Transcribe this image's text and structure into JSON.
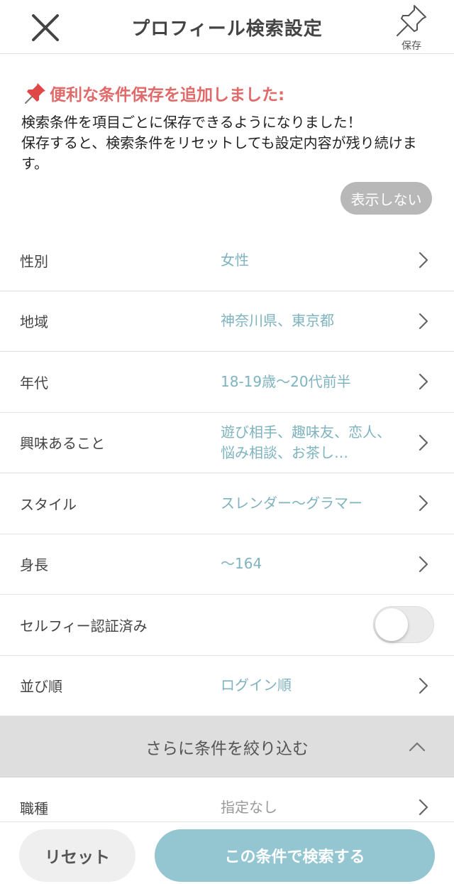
{
  "header": {
    "title": "プロフィール検索設定",
    "save_label": "保存"
  },
  "notice": {
    "title": "便利な条件保存を追加しました:",
    "body": "検索条件を項目ごとに保存できるようになりました！\n保存すると、検索条件をリセットしても設定内容が残り続けます。",
    "hide_label": "表示しない"
  },
  "filters": [
    {
      "label": "性別",
      "value": "女性"
    },
    {
      "label": "地域",
      "value": "神奈川県、東京都"
    },
    {
      "label": "年代",
      "value": "18-19歳〜20代前半"
    },
    {
      "label": "興味あること",
      "value": "遊び相手、趣味友、恋人、悩み相談、お茶し…"
    },
    {
      "label": "スタイル",
      "value": "スレンダー〜グラマー"
    },
    {
      "label": "身長",
      "value": "〜164"
    },
    {
      "label": "セルフィー認証済み",
      "toggle": false
    },
    {
      "label": "並び順",
      "value": "ログイン順"
    }
  ],
  "more_section": {
    "label": "さらに条件を絞り込む"
  },
  "extra_filters": [
    {
      "label": "職種",
      "value": "指定なし"
    }
  ],
  "footer": {
    "reset_label": "リセット",
    "search_label": "この条件で検索する"
  },
  "colors": {
    "accent": "#93c6d1",
    "value_text": "#7fb3bf",
    "notice_title": "#e06a6a",
    "hide_button": "#b8b8b8"
  }
}
